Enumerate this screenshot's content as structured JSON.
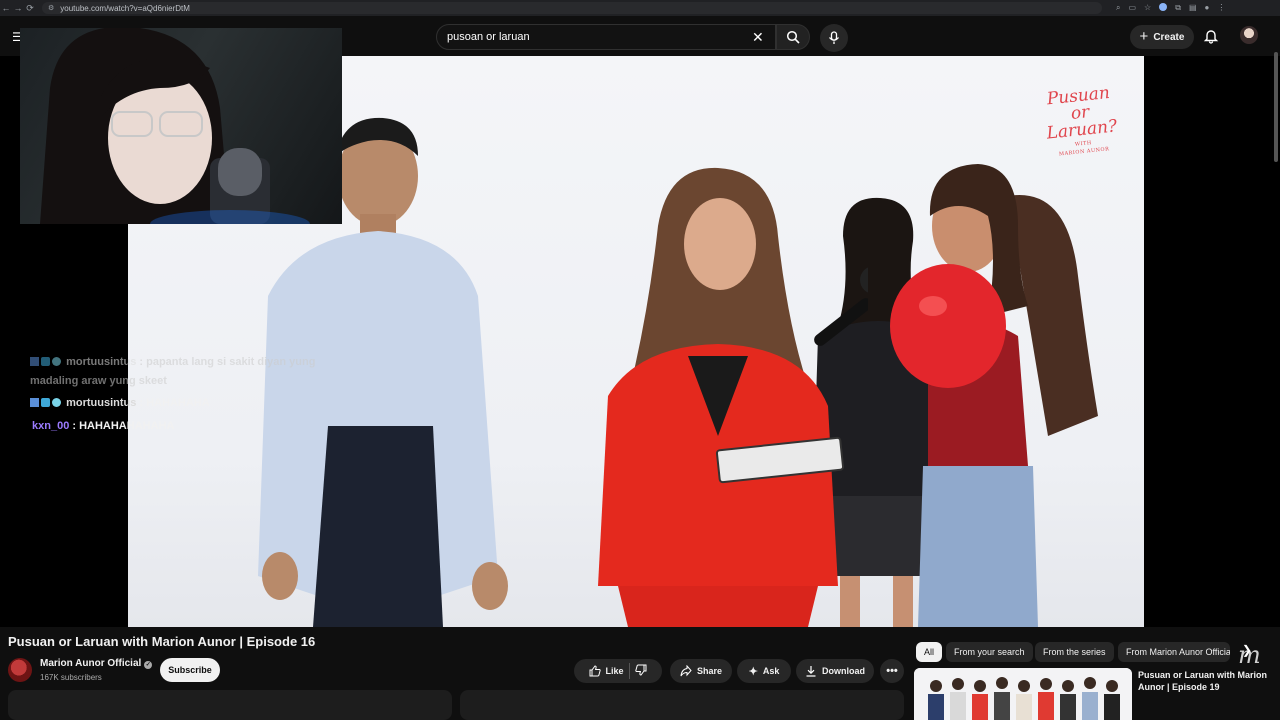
{
  "browser": {
    "url": "youtube.com/watch?v=aQd6nierDtM",
    "nav": [
      "←",
      "→",
      "⟳"
    ]
  },
  "masthead": {
    "search_value": "pusoan or laruan",
    "create_label": "Create"
  },
  "video": {
    "logo_line1": "Pusuan",
    "logo_line2": "or",
    "logo_line3": "Laruan?",
    "logo_with": "WITH",
    "logo_host": "MARION AUNOR",
    "watermark": "m"
  },
  "chat": [
    {
      "user": "mortuusintus",
      "message": " : papanta lang si sakit diyan yung",
      "message_cont": "madaling araw yung skeet",
      "faded": true
    },
    {
      "user": "mortuusintus",
      "message": " : HAHAHAHA",
      "faded": false
    },
    {
      "user": "kxn_00",
      "message": " : HAHAHAHAHAHA",
      "faded": false
    }
  ],
  "watch": {
    "title": "Pusuan or Laruan with Marion Aunor | Episode 16",
    "channel": "Marion Aunor Official",
    "subscribers": "167K subscribers",
    "subscribe_label": "Subscribe",
    "like_label": "Like",
    "share_label": "Share",
    "ask_label": "Ask",
    "download_label": "Download"
  },
  "recommendations": {
    "chips": [
      "All",
      "From your search",
      "From the series",
      "From Marion Aunor Official"
    ],
    "first_title": "Pusuan or Laruan with Marion Aunor | Episode 19"
  },
  "colors": {
    "accent_red": "#e0454d",
    "chat_user_purple": "#9b7bff",
    "background": "#0f0f0f"
  }
}
